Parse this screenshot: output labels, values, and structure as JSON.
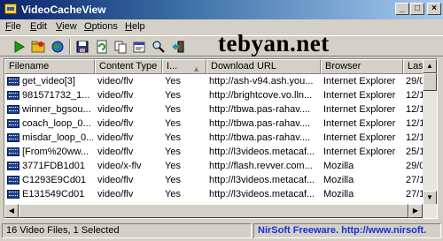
{
  "window": {
    "title": "VideoCacheView"
  },
  "title_buttons": {
    "minimize": "_",
    "maximize": "□",
    "close": "×"
  },
  "menu": [
    {
      "label": "File",
      "key": "F",
      "rest": "ile"
    },
    {
      "label": "Edit",
      "key": "E",
      "rest": "dit"
    },
    {
      "label": "View",
      "key": "V",
      "rest": "iew"
    },
    {
      "label": "Options",
      "key": "O",
      "rest": "ptions"
    },
    {
      "label": "Help",
      "key": "H",
      "rest": "elp"
    }
  ],
  "toolbar_icons": [
    "play-icon",
    "open-folder-icon",
    "globe-icon",
    "save-icon",
    "refresh-icon",
    "copy-icon",
    "properties-icon",
    "find-icon",
    "exit-icon"
  ],
  "watermark": "tebyan.net",
  "columns": [
    "Filename",
    "Content Type",
    "I...",
    "Download URL",
    "Browser",
    "Last ..."
  ],
  "rows": [
    [
      "get_video[3]",
      "video/flv",
      "Yes",
      "http://ash-v94.ash.you...",
      "Internet Explorer",
      "29/0"
    ],
    [
      "981571732_1...",
      "video/flv",
      "Yes",
      "http://brightcove.vo.lln...",
      "Internet Explorer",
      "12/1"
    ],
    [
      "winner_bgsou...",
      "video/flv",
      "Yes",
      "http://tbwa.pas-rahav....",
      "Internet Explorer",
      "12/1"
    ],
    [
      "coach_loop_0...",
      "video/flv",
      "Yes",
      "http://tbwa.pas-rahav....",
      "Internet Explorer",
      "12/1"
    ],
    [
      "misdar_loop_0...",
      "video/flv",
      "Yes",
      "http://tbwa.pas-rahav....",
      "Internet Explorer",
      "12/1"
    ],
    [
      "[From%20ww...",
      "video/flv",
      "Yes",
      "http://l3videos.metacaf...",
      "Internet Explorer",
      "25/1"
    ],
    [
      "3771FDB1d01",
      "video/x-flv",
      "Yes",
      "http://flash.revver.com...",
      "Mozilla",
      "29/0"
    ],
    [
      "C1293E9Cd01",
      "video/flv",
      "Yes",
      "http://l3videos.metacaf...",
      "Mozilla",
      "27/1"
    ],
    [
      "E131549Cd01",
      "video/flv",
      "Yes",
      "http://l3videos.metacaf...",
      "Mozilla",
      "27/1"
    ]
  ],
  "status": {
    "count": "16 Video Files, 1 Selected",
    "credit": "NirSoft Freeware.  http://www.nirsoft."
  },
  "colors": {
    "title_start": "#0a246a",
    "title_end": "#a6caf0",
    "face": "#d4d0c8",
    "link": "#1a2fd6"
  }
}
